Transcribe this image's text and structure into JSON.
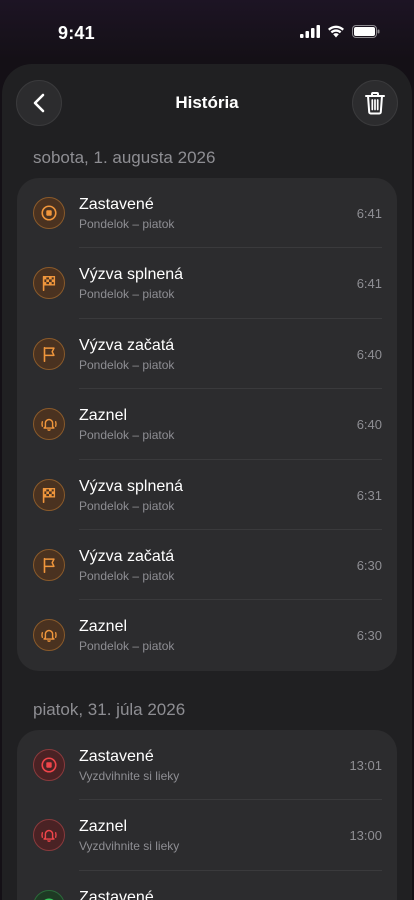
{
  "status_bar": {
    "time": "9:41"
  },
  "nav": {
    "title": "História"
  },
  "sections": [
    {
      "date": "sobota, 1. augusta 2026",
      "rows": [
        {
          "title": "Zastavené",
          "subtitle": "Pondelok – piatok",
          "time": "6:41",
          "icon": "stop-icon",
          "color": "orange"
        },
        {
          "title": "Výzva splnená",
          "subtitle": "Pondelok – piatok",
          "time": "6:41",
          "icon": "checkered-flag-icon",
          "color": "orange"
        },
        {
          "title": "Výzva začatá",
          "subtitle": "Pondelok – piatok",
          "time": "6:40",
          "icon": "flag-icon",
          "color": "orange"
        },
        {
          "title": "Zaznel",
          "subtitle": "Pondelok – piatok",
          "time": "6:40",
          "icon": "ringing-bell-icon",
          "color": "orange"
        },
        {
          "title": "Výzva splnená",
          "subtitle": "Pondelok – piatok",
          "time": "6:31",
          "icon": "checkered-flag-icon",
          "color": "orange"
        },
        {
          "title": "Výzva začatá",
          "subtitle": "Pondelok – piatok",
          "time": "6:30",
          "icon": "flag-icon",
          "color": "orange"
        },
        {
          "title": "Zaznel",
          "subtitle": "Pondelok – piatok",
          "time": "6:30",
          "icon": "ringing-bell-icon",
          "color": "orange"
        }
      ]
    },
    {
      "date": "piatok, 31. júla 2026",
      "rows": [
        {
          "title": "Zastavené",
          "subtitle": "Vyzdvihnite si lieky",
          "time": "13:01",
          "icon": "stop-icon",
          "color": "red"
        },
        {
          "title": "Zaznel",
          "subtitle": "Vyzdvihnite si lieky",
          "time": "13:00",
          "icon": "ringing-bell-icon",
          "color": "red"
        },
        {
          "title": "Zastavené",
          "subtitle": "",
          "time": "",
          "icon": "stop-icon",
          "color": "green"
        }
      ]
    }
  ],
  "colors": {
    "orange": "#f0963c",
    "red": "#f0454a",
    "green": "#34c759"
  }
}
